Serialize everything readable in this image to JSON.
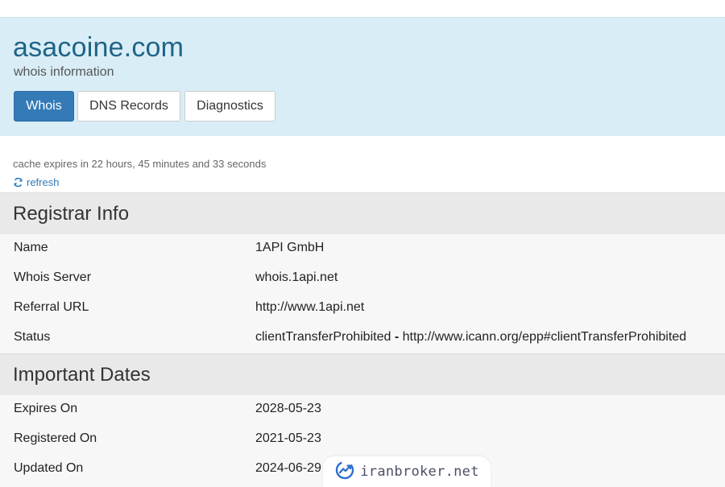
{
  "header": {
    "domain": "asacoine.com",
    "subtitle": "whois information",
    "tabs": [
      {
        "label": "Whois",
        "active": true
      },
      {
        "label": "DNS Records",
        "active": false
      },
      {
        "label": "Diagnostics",
        "active": false
      }
    ]
  },
  "cache": {
    "text": "cache expires in 22 hours, 45 minutes and 33 seconds",
    "refresh_label": "refresh"
  },
  "registrar": {
    "title": "Registrar Info",
    "rows": [
      {
        "key": "Name",
        "value": "1API GmbH"
      },
      {
        "key": "Whois Server",
        "value": "whois.1api.net"
      },
      {
        "key": "Referral URL",
        "value": "http://www.1api.net"
      },
      {
        "key": "Status",
        "value_main": "clientTransferProhibited",
        "separator": " - ",
        "value_link": "http://www.icann.org/epp#clientTransferProhibited"
      }
    ]
  },
  "dates": {
    "title": "Important Dates",
    "rows": [
      {
        "key": "Expires On",
        "value": "2028-05-23"
      },
      {
        "key": "Registered On",
        "value": "2021-05-23"
      },
      {
        "key": "Updated On",
        "value": "2024-06-29"
      }
    ]
  },
  "watermark": {
    "text": "iranbroker.net"
  },
  "colors": {
    "header_bg": "#d9edf7",
    "title_blue": "#1f6487",
    "primary": "#337ab7",
    "section_bg": "#e9e9e9",
    "row_bg": "#f7f7f7"
  }
}
